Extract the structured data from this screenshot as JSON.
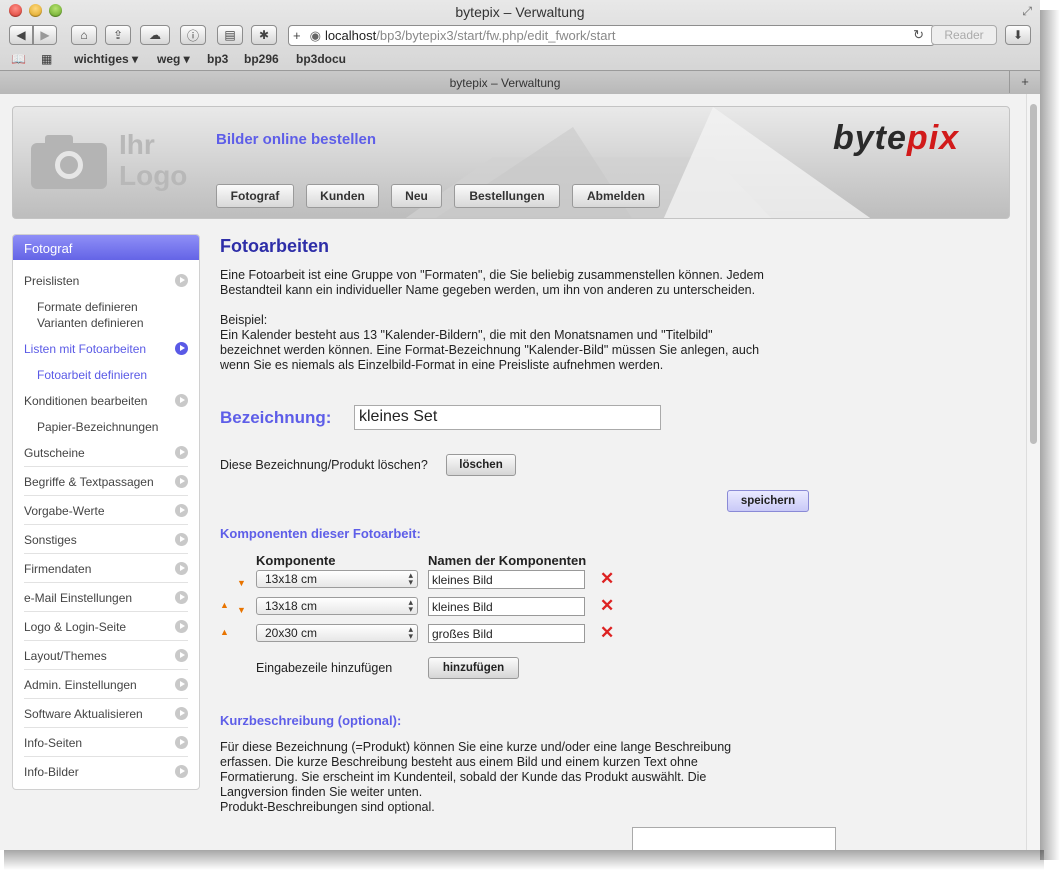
{
  "browser": {
    "window_title": "bytepix – Verwaltung",
    "url_host": "localhost",
    "url_path": "/bp3/bytepix3/start/fw.php/edit_fwork/start",
    "reader_label": "Reader",
    "bookmarks": [
      "wichtiges",
      "weg",
      "bp3",
      "bp296",
      "bp3docu"
    ],
    "tab_title": "bytepix – Verwaltung"
  },
  "header": {
    "logo_line1": "Ihr",
    "logo_line2": "Logo",
    "tagline": "Bilder online bestellen",
    "brand_a": "byte",
    "brand_b": "pix",
    "nav": [
      "Fotograf",
      "Kunden",
      "Neu",
      "Bestellungen",
      "Abmelden"
    ]
  },
  "sidebar": {
    "title": "Fotograf",
    "items": [
      {
        "label": "Preislisten"
      },
      {
        "label": "Listen mit Fotoarbeiten"
      },
      {
        "label": "Konditionen bearbeiten"
      },
      {
        "label": "Gutscheine"
      },
      {
        "label": "Begriffe & Textpassagen"
      },
      {
        "label": "Vorgabe-Werte"
      },
      {
        "label": "Sonstiges"
      },
      {
        "label": "Firmendaten"
      },
      {
        "label": "e-Mail Einstellungen"
      },
      {
        "label": "Logo & Login-Seite"
      },
      {
        "label": "Layout/Themes"
      },
      {
        "label": "Admin. Einstellungen"
      },
      {
        "label": "Software Aktualisieren"
      },
      {
        "label": "Info-Seiten"
      },
      {
        "label": "Info-Bilder"
      }
    ],
    "subitems": {
      "preislisten": [
        "Formate definieren",
        "Varianten definieren"
      ],
      "listen": [
        "Fotoarbeit definieren"
      ],
      "konditionen": [
        "Papier-Bezeichnungen"
      ]
    }
  },
  "main": {
    "title": "Fotoarbeiten",
    "intro_lines": [
      "Eine Fotoarbeit ist eine Gruppe von \"Formaten\", die Sie beliebig zusammenstellen können. Jedem",
      "Bestandteil kann ein individueller Name gegeben werden, um ihn von anderen zu unterscheiden."
    ],
    "example_lines": [
      "Beispiel:",
      "Ein Kalender besteht aus 13 \"Kalender-Bildern\", die mit den Monatsnamen und \"Titelbild\"",
      "bezeichnet werden können. Eine Format-Bezeichnung \"Kalender-Bild\" müssen Sie anlegen, auch",
      "wenn Sie es niemals als Einzelbild-Format in eine Preisliste aufnehmen werden."
    ],
    "bez_label": "Bezeichnung:",
    "bez_value": "kleines Set",
    "delete_question": "Diese Bezeichnung/Produkt löschen?",
    "delete_button": "löschen",
    "save_button": "speichern",
    "components_title": "Komponenten dieser Fotoarbeit:",
    "col_component": "Komponente",
    "col_names": "Namen der Komponenten",
    "components": [
      {
        "format": "13x18 cm",
        "name": "kleines Bild"
      },
      {
        "format": "13x18 cm",
        "name": "kleines Bild"
      },
      {
        "format": "20x30 cm",
        "name": "großes Bild"
      }
    ],
    "add_row_label": "Eingabezeile hinzufügen",
    "add_button": "hinzufügen",
    "short_desc_title": "Kurzbeschreibung (optional):",
    "short_desc_lines": [
      "Für diese Bezeichnung (=Produkt) können Sie eine kurze und/oder eine lange Beschreibung",
      "erfassen. Die kurze Beschreibung besteht aus einem Bild und einem kurzen Text ohne",
      "Formatierung. Sie erscheint im Kundenteil, sobald der Kunde das Produkt auswählt. Die",
      "Langversion finden Sie weiter unten.",
      "Produkt-Beschreibungen sind optional."
    ]
  }
}
